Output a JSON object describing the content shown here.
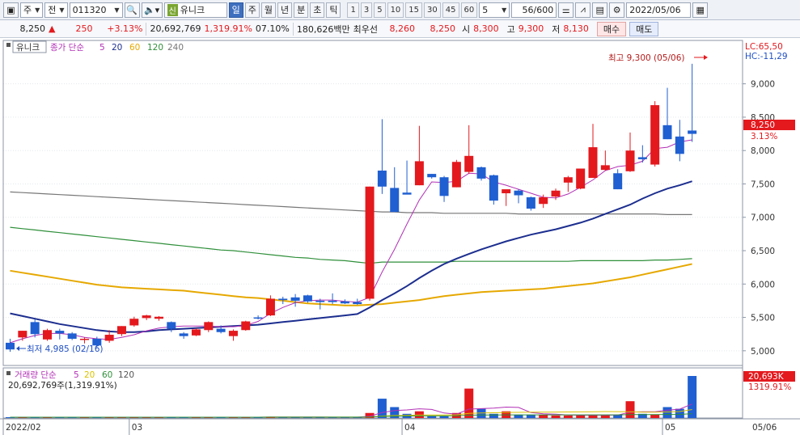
{
  "toolbar": {
    "period_unit": "주",
    "prev_label": "전",
    "code": "011320",
    "stock_name": "유니크",
    "shin_label": "신",
    "periods": [
      "일",
      "주",
      "월",
      "년",
      "분",
      "초",
      "틱"
    ],
    "active_period": "일",
    "intervals": [
      "1",
      "3",
      "5",
      "10",
      "15",
      "30",
      "45",
      "60"
    ],
    "interval_select": "5",
    "count": "56/600",
    "date": "2022/05/06"
  },
  "info": {
    "price": "8,250",
    "change_symbol": "▲",
    "change": "250",
    "change_rate": "+3.13%",
    "volume": "20,692,769",
    "volume_ratio": "1,319.91%",
    "turnover": "07.10%",
    "amount": "180,626백만",
    "best_ask_label": "최우선",
    "best_ask": "8,260",
    "best_bid": "8,250",
    "open_label": "시",
    "open": "8,300",
    "high_label": "고",
    "high": "9,300",
    "low_label": "저",
    "low": "8,130",
    "sell_label": "매수",
    "buy_label": "매도"
  },
  "legend": {
    "stock": "유니크",
    "ma_title": "종가 단순",
    "ma_periods": [
      "5",
      "20",
      "60",
      "120",
      "240"
    ],
    "ma_colors": [
      "#b230b6",
      "#1c2e8f",
      "#e6a800",
      "#2f8f3a",
      "#777777"
    ],
    "lc": "LC:65,50",
    "hc": "HC:-11,29",
    "vol_title": "거래량 단순",
    "vol_periods": [
      "5",
      "20",
      "60",
      "120"
    ],
    "vol_colors": [
      "#b230b6",
      "#d9c200",
      "#2f8f3a",
      "#555555"
    ],
    "vol_value": "20,692,769주(1,319.91%)"
  },
  "annotations": {
    "high": "최고 9,300 (05/06)",
    "low": "최저 4,985 (02/16)",
    "current_price": "8,250",
    "current_rate": "3.13%",
    "vol_current": "20,693K",
    "vol_rate": "1319.91%"
  },
  "chart_data": {
    "type": "candlestick",
    "y_ticks": [
      5000,
      5500,
      6000,
      6500,
      7000,
      7500,
      8000,
      8500,
      9000
    ],
    "y_tick_labels": [
      "5,000",
      "5,500",
      "6,000",
      "6,500",
      "7,000",
      "7,500",
      "8,000",
      "8,500",
      "9,000"
    ],
    "ylim": [
      4780,
      9650
    ],
    "x_month_labels": [
      {
        "label": "2022/02",
        "index": 0
      },
      {
        "label": "03",
        "index": 10
      },
      {
        "label": "04",
        "index": 32
      },
      {
        "label": "05",
        "index": 53
      }
    ],
    "x_end_label": "05/06",
    "candles": [
      {
        "o": 5120,
        "h": 5180,
        "l": 4985,
        "c": 5020
      },
      {
        "o": 5200,
        "h": 5300,
        "l": 5150,
        "c": 5300
      },
      {
        "o": 5430,
        "h": 5470,
        "l": 5200,
        "c": 5250
      },
      {
        "o": 5170,
        "h": 5330,
        "l": 5150,
        "c": 5310
      },
      {
        "o": 5300,
        "h": 5330,
        "l": 5170,
        "c": 5260
      },
      {
        "o": 5260,
        "h": 5280,
        "l": 5160,
        "c": 5180
      },
      {
        "o": 5170,
        "h": 5200,
        "l": 5110,
        "c": 5180
      },
      {
        "o": 5180,
        "h": 5210,
        "l": 5050,
        "c": 5080
      },
      {
        "o": 5150,
        "h": 5310,
        "l": 5120,
        "c": 5240
      },
      {
        "o": 5250,
        "h": 5370,
        "l": 5220,
        "c": 5370
      },
      {
        "o": 5380,
        "h": 5510,
        "l": 5360,
        "c": 5480
      },
      {
        "o": 5490,
        "h": 5540,
        "l": 5460,
        "c": 5530
      },
      {
        "o": 5480,
        "h": 5520,
        "l": 5450,
        "c": 5510
      },
      {
        "o": 5430,
        "h": 5440,
        "l": 5280,
        "c": 5330
      },
      {
        "o": 5260,
        "h": 5280,
        "l": 5180,
        "c": 5220
      },
      {
        "o": 5230,
        "h": 5340,
        "l": 5220,
        "c": 5320
      },
      {
        "o": 5310,
        "h": 5440,
        "l": 5280,
        "c": 5430
      },
      {
        "o": 5330,
        "h": 5380,
        "l": 5260,
        "c": 5280
      },
      {
        "o": 5220,
        "h": 5320,
        "l": 5150,
        "c": 5300
      },
      {
        "o": 5310,
        "h": 5450,
        "l": 5300,
        "c": 5440
      },
      {
        "o": 5500,
        "h": 5530,
        "l": 5470,
        "c": 5490
      },
      {
        "o": 5530,
        "h": 5830,
        "l": 5520,
        "c": 5780
      },
      {
        "o": 5780,
        "h": 5810,
        "l": 5700,
        "c": 5760
      },
      {
        "o": 5800,
        "h": 5850,
        "l": 5660,
        "c": 5750
      },
      {
        "o": 5830,
        "h": 5840,
        "l": 5720,
        "c": 5740
      },
      {
        "o": 5750,
        "h": 5780,
        "l": 5620,
        "c": 5730
      },
      {
        "o": 5750,
        "h": 5860,
        "l": 5700,
        "c": 5730
      },
      {
        "o": 5740,
        "h": 5770,
        "l": 5700,
        "c": 5710
      },
      {
        "o": 5730,
        "h": 5780,
        "l": 5690,
        "c": 5700
      },
      {
        "o": 5780,
        "h": 7460,
        "l": 5750,
        "c": 7460
      },
      {
        "o": 7700,
        "h": 8470,
        "l": 7350,
        "c": 7460
      },
      {
        "o": 7440,
        "h": 7750,
        "l": 7080,
        "c": 7080
      },
      {
        "o": 7370,
        "h": 7850,
        "l": 7350,
        "c": 7340
      },
      {
        "o": 7480,
        "h": 8370,
        "l": 7480,
        "c": 7840
      },
      {
        "o": 7650,
        "h": 7650,
        "l": 7580,
        "c": 7600
      },
      {
        "o": 7600,
        "h": 7620,
        "l": 7230,
        "c": 7320
      },
      {
        "o": 7450,
        "h": 7860,
        "l": 7450,
        "c": 7830
      },
      {
        "o": 7680,
        "h": 8380,
        "l": 7650,
        "c": 7920
      },
      {
        "o": 7750,
        "h": 7760,
        "l": 7550,
        "c": 7580
      },
      {
        "o": 7630,
        "h": 7640,
        "l": 7190,
        "c": 7250
      },
      {
        "o": 7360,
        "h": 7380,
        "l": 7170,
        "c": 7420
      },
      {
        "o": 7400,
        "h": 7420,
        "l": 7210,
        "c": 7330
      },
      {
        "o": 7300,
        "h": 7310,
        "l": 7100,
        "c": 7130
      },
      {
        "o": 7200,
        "h": 7340,
        "l": 7140,
        "c": 7300
      },
      {
        "o": 7310,
        "h": 7430,
        "l": 7260,
        "c": 7400
      },
      {
        "o": 7520,
        "h": 7620,
        "l": 7380,
        "c": 7600
      },
      {
        "o": 7430,
        "h": 7730,
        "l": 7420,
        "c": 7730
      },
      {
        "o": 7590,
        "h": 8400,
        "l": 7590,
        "c": 8050
      },
      {
        "o": 7710,
        "h": 8000,
        "l": 7700,
        "c": 7780
      },
      {
        "o": 7660,
        "h": 7720,
        "l": 7420,
        "c": 7420
      },
      {
        "o": 7690,
        "h": 8270,
        "l": 7680,
        "c": 8000
      },
      {
        "o": 7900,
        "h": 8080,
        "l": 7820,
        "c": 7870
      },
      {
        "o": 7790,
        "h": 8740,
        "l": 7760,
        "c": 8680
      },
      {
        "o": 8380,
        "h": 8940,
        "l": 8170,
        "c": 8170
      },
      {
        "o": 8210,
        "h": 8460,
        "l": 7840,
        "c": 7950
      },
      {
        "o": 8300,
        "h": 9300,
        "l": 8130,
        "c": 8250
      }
    ],
    "ma5": [
      5120,
      5180,
      5230,
      5260,
      5260,
      5240,
      5200,
      5180,
      5170,
      5200,
      5240,
      5300,
      5340,
      5360,
      5370,
      5370,
      5370,
      5360,
      5360,
      5380,
      5440,
      5560,
      5650,
      5720,
      5750,
      5760,
      5760,
      5740,
      5730,
      5800,
      6180,
      6520,
      6900,
      7260,
      7530,
      7520,
      7540,
      7660,
      7650,
      7530,
      7480,
      7420,
      7360,
      7300,
      7290,
      7350,
      7450,
      7560,
      7700,
      7760,
      7780,
      7840,
      8030,
      8050,
      8130,
      8160
    ],
    "ma20": [
      5560,
      5520,
      5480,
      5440,
      5400,
      5370,
      5340,
      5310,
      5290,
      5280,
      5280,
      5290,
      5310,
      5320,
      5330,
      5340,
      5350,
      5360,
      5370,
      5380,
      5390,
      5410,
      5430,
      5450,
      5470,
      5490,
      5510,
      5530,
      5550,
      5650,
      5760,
      5860,
      5970,
      6090,
      6200,
      6300,
      6380,
      6450,
      6520,
      6580,
      6640,
      6690,
      6740,
      6780,
      6820,
      6870,
      6920,
      6980,
      7050,
      7120,
      7190,
      7280,
      7360,
      7430,
      7480,
      7540
    ],
    "ma60": [
      6200,
      6170,
      6140,
      6110,
      6080,
      6050,
      6020,
      5990,
      5970,
      5950,
      5940,
      5930,
      5920,
      5910,
      5900,
      5880,
      5860,
      5840,
      5820,
      5800,
      5790,
      5770,
      5750,
      5730,
      5710,
      5700,
      5690,
      5680,
      5680,
      5690,
      5700,
      5720,
      5740,
      5760,
      5790,
      5820,
      5840,
      5860,
      5880,
      5890,
      5900,
      5910,
      5920,
      5930,
      5950,
      5970,
      5990,
      6010,
      6040,
      6070,
      6100,
      6140,
      6180,
      6220,
      6260,
      6300
    ],
    "ma120": [
      6850,
      6830,
      6810,
      6790,
      6770,
      6750,
      6730,
      6710,
      6690,
      6670,
      6650,
      6630,
      6610,
      6590,
      6570,
      6550,
      6530,
      6510,
      6500,
      6480,
      6460,
      6440,
      6420,
      6400,
      6390,
      6370,
      6360,
      6350,
      6330,
      6310,
      6330,
      6330,
      6330,
      6330,
      6330,
      6330,
      6340,
      6340,
      6340,
      6340,
      6340,
      6340,
      6340,
      6340,
      6340,
      6340,
      6350,
      6350,
      6350,
      6350,
      6350,
      6350,
      6360,
      6360,
      6370,
      6380
    ],
    "ma240": [
      7380,
      7370,
      7360,
      7350,
      7340,
      7330,
      7320,
      7310,
      7300,
      7290,
      7280,
      7270,
      7260,
      7250,
      7240,
      7230,
      7220,
      7210,
      7200,
      7190,
      7180,
      7170,
      7160,
      7150,
      7140,
      7130,
      7120,
      7110,
      7100,
      7090,
      7080,
      7080,
      7070,
      7070,
      7070,
      7060,
      7060,
      7060,
      7060,
      7060,
      7060,
      7050,
      7050,
      7050,
      7050,
      7050,
      7050,
      7050,
      7050,
      7050,
      7050,
      7050,
      7050,
      7040,
      7040,
      7040
    ],
    "volume_ratio_to_max": [
      0.02,
      0.02,
      0.02,
      0.02,
      0.02,
      0.02,
      0.02,
      0.02,
      0.02,
      0.02,
      0.02,
      0.02,
      0.02,
      0.02,
      0.02,
      0.02,
      0.02,
      0.02,
      0.02,
      0.02,
      0.02,
      0.03,
      0.02,
      0.02,
      0.02,
      0.02,
      0.02,
      0.02,
      0.02,
      0.12,
      0.46,
      0.26,
      0.1,
      0.16,
      0.04,
      0.04,
      0.12,
      0.7,
      0.22,
      0.1,
      0.16,
      0.08,
      0.08,
      0.08,
      0.06,
      0.06,
      0.06,
      0.08,
      0.08,
      0.08,
      0.4,
      0.1,
      0.08,
      0.26,
      0.22,
      1.0
    ]
  }
}
